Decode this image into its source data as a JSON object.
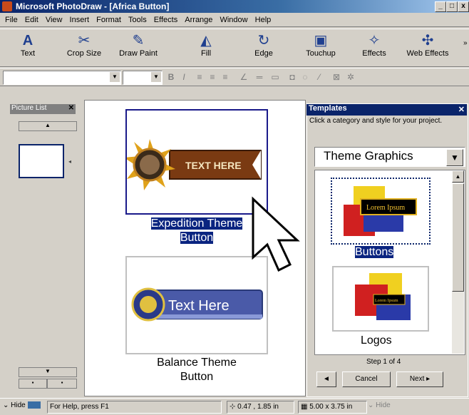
{
  "window": {
    "title": "Microsoft PhotoDraw - [Africa Button]",
    "caption_buttons": [
      "_",
      "□",
      "x"
    ]
  },
  "menu": [
    "File",
    "Edit",
    "View",
    "Insert",
    "Format",
    "Tools",
    "Effects",
    "Arrange",
    "Window",
    "Help"
  ],
  "toolbar": [
    {
      "label": "Text",
      "icon": "text-icon"
    },
    {
      "label": "Crop Size",
      "icon": "crop-icon"
    },
    {
      "label": "Draw Paint",
      "icon": "draw-paint-icon"
    },
    {
      "label": "Fill",
      "icon": "fill-icon"
    },
    {
      "label": "Edge",
      "icon": "edge-icon"
    },
    {
      "label": "Touchup",
      "icon": "touchup-icon"
    },
    {
      "label": "Effects",
      "icon": "effects-icon"
    },
    {
      "label": "Web Effects",
      "icon": "web-effects-icon"
    }
  ],
  "picture_list": {
    "title": "Picture List"
  },
  "canvas": {
    "items": [
      {
        "banner_text": "TEXT HERE",
        "caption_line1": "Expedition Theme",
        "caption_line2": "Button",
        "selected": true
      },
      {
        "banner_text": "Text Here",
        "caption_line1": "Balance Theme",
        "caption_line2": "Button",
        "selected": false
      }
    ]
  },
  "templates": {
    "title": "Templates",
    "hint": "Click a category and style for your project.",
    "category": "Theme Graphics",
    "items": [
      {
        "label": "Buttons",
        "thumb_text": "Lorem Ipsum",
        "selected": true
      },
      {
        "label": "Logos",
        "thumb_text": "Lorem Ipsum",
        "selected": false
      }
    ],
    "step": "Step 1 of 4",
    "back_label": "◄",
    "cancel_label": "Cancel",
    "next_label": "Next ▸"
  },
  "status": {
    "hide_left": "Hide",
    "help": "For Help, press F1",
    "position": "0.47 , 1.85 in",
    "size": "5.00 x 3.75 in",
    "hide_right": "Hide"
  },
  "colors": {
    "title_bar": "#0a246a",
    "selection": "#0a2480",
    "expedition_banner": "#7a3a12",
    "balance_banner": "#4a5aa8"
  }
}
